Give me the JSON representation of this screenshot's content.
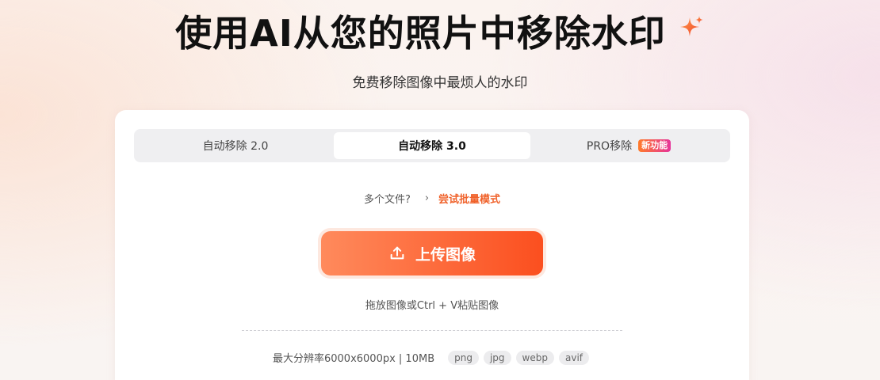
{
  "hero": {
    "title": "使用AI从您的照片中移除水印",
    "subtitle": "免费移除图像中最烦人的水印",
    "sparkle_icon": "sparkle-icon",
    "accent": "#f0622b"
  },
  "tabs": [
    {
      "label": "自动移除 2.0",
      "active": false
    },
    {
      "label": "自动移除 3.0",
      "active": true
    },
    {
      "label": "PRO移除",
      "active": false,
      "badge": "新功能"
    }
  ],
  "batch": {
    "question": "多个文件?",
    "link": "尝试批量模式"
  },
  "upload": {
    "label": "上传图像",
    "icon": "upload-icon",
    "hint": "拖放图像或Ctrl + V粘贴图像"
  },
  "specs": {
    "limit": "最大分辨率6000x6000px | 10MB",
    "formats": [
      "png",
      "jpg",
      "webp",
      "avif"
    ]
  }
}
